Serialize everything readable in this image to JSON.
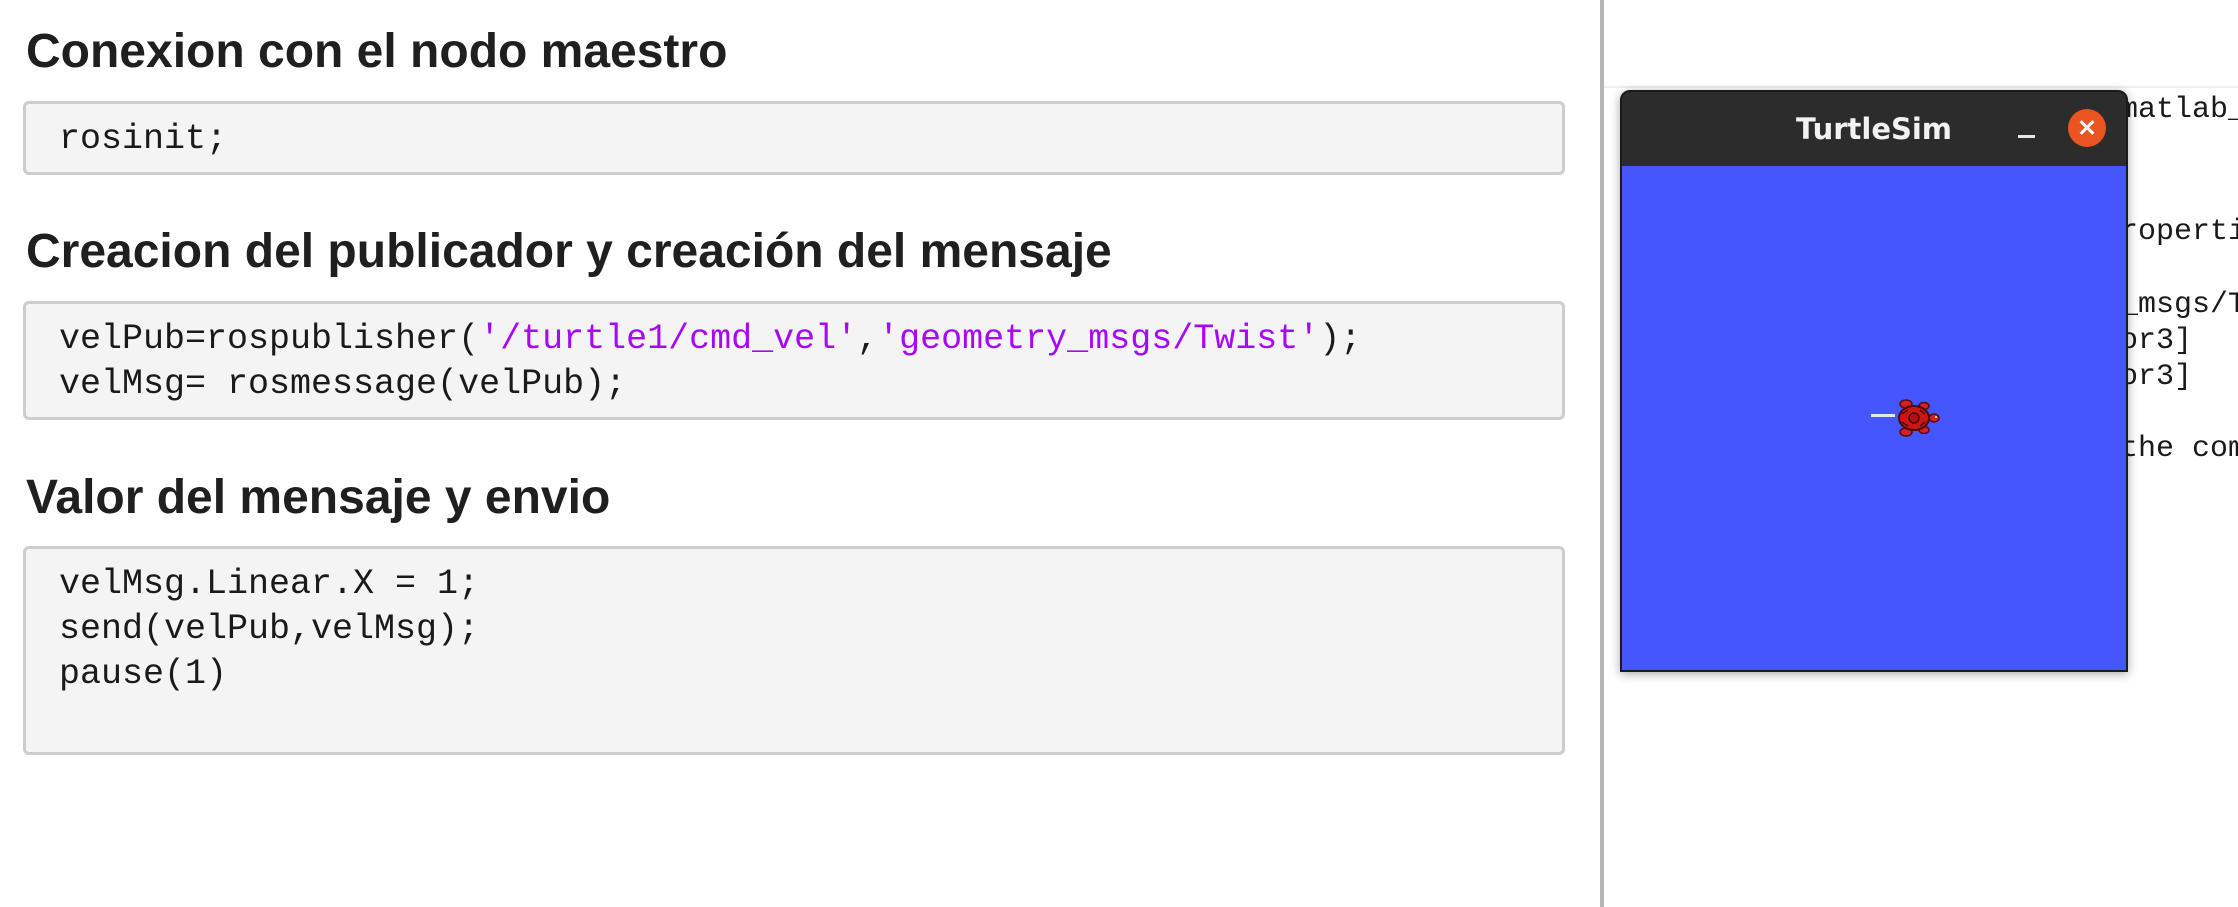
{
  "left": {
    "sections": [
      {
        "title": "Conexion con el nodo maestro",
        "code": [
          "rosinit;"
        ]
      },
      {
        "title": "Creacion del publicador y creación del mensaje",
        "code_line1": {
          "a": "velPub=rospublisher(",
          "s1": "'/turtle1/cmd_vel'",
          "comma": ",",
          "s2": "'geometry_msgs/Twist'",
          "end": ");"
        },
        "code_line2": "velMsg= rosmessage(velPub);"
      },
      {
        "title": "Valor del mensaje y envio",
        "code": [
          "velMsg.Linear.X = 1;",
          "send(velPub,velMsg);",
          "pause(1)"
        ]
      }
    ],
    "string_color": "#a709f5"
  },
  "right": {
    "lines": [
      "matlab_",
      "roperti",
      "_msgs/T",
      "or3]",
      "or3]",
      "the com"
    ]
  },
  "turtlesim": {
    "title": "TurtleSim",
    "minimize_icon": "minimize-icon",
    "close_icon": "close-icon",
    "close_color": "#e95420",
    "background_color": "#4556ff",
    "turtle_icon": "turtle-icon"
  }
}
